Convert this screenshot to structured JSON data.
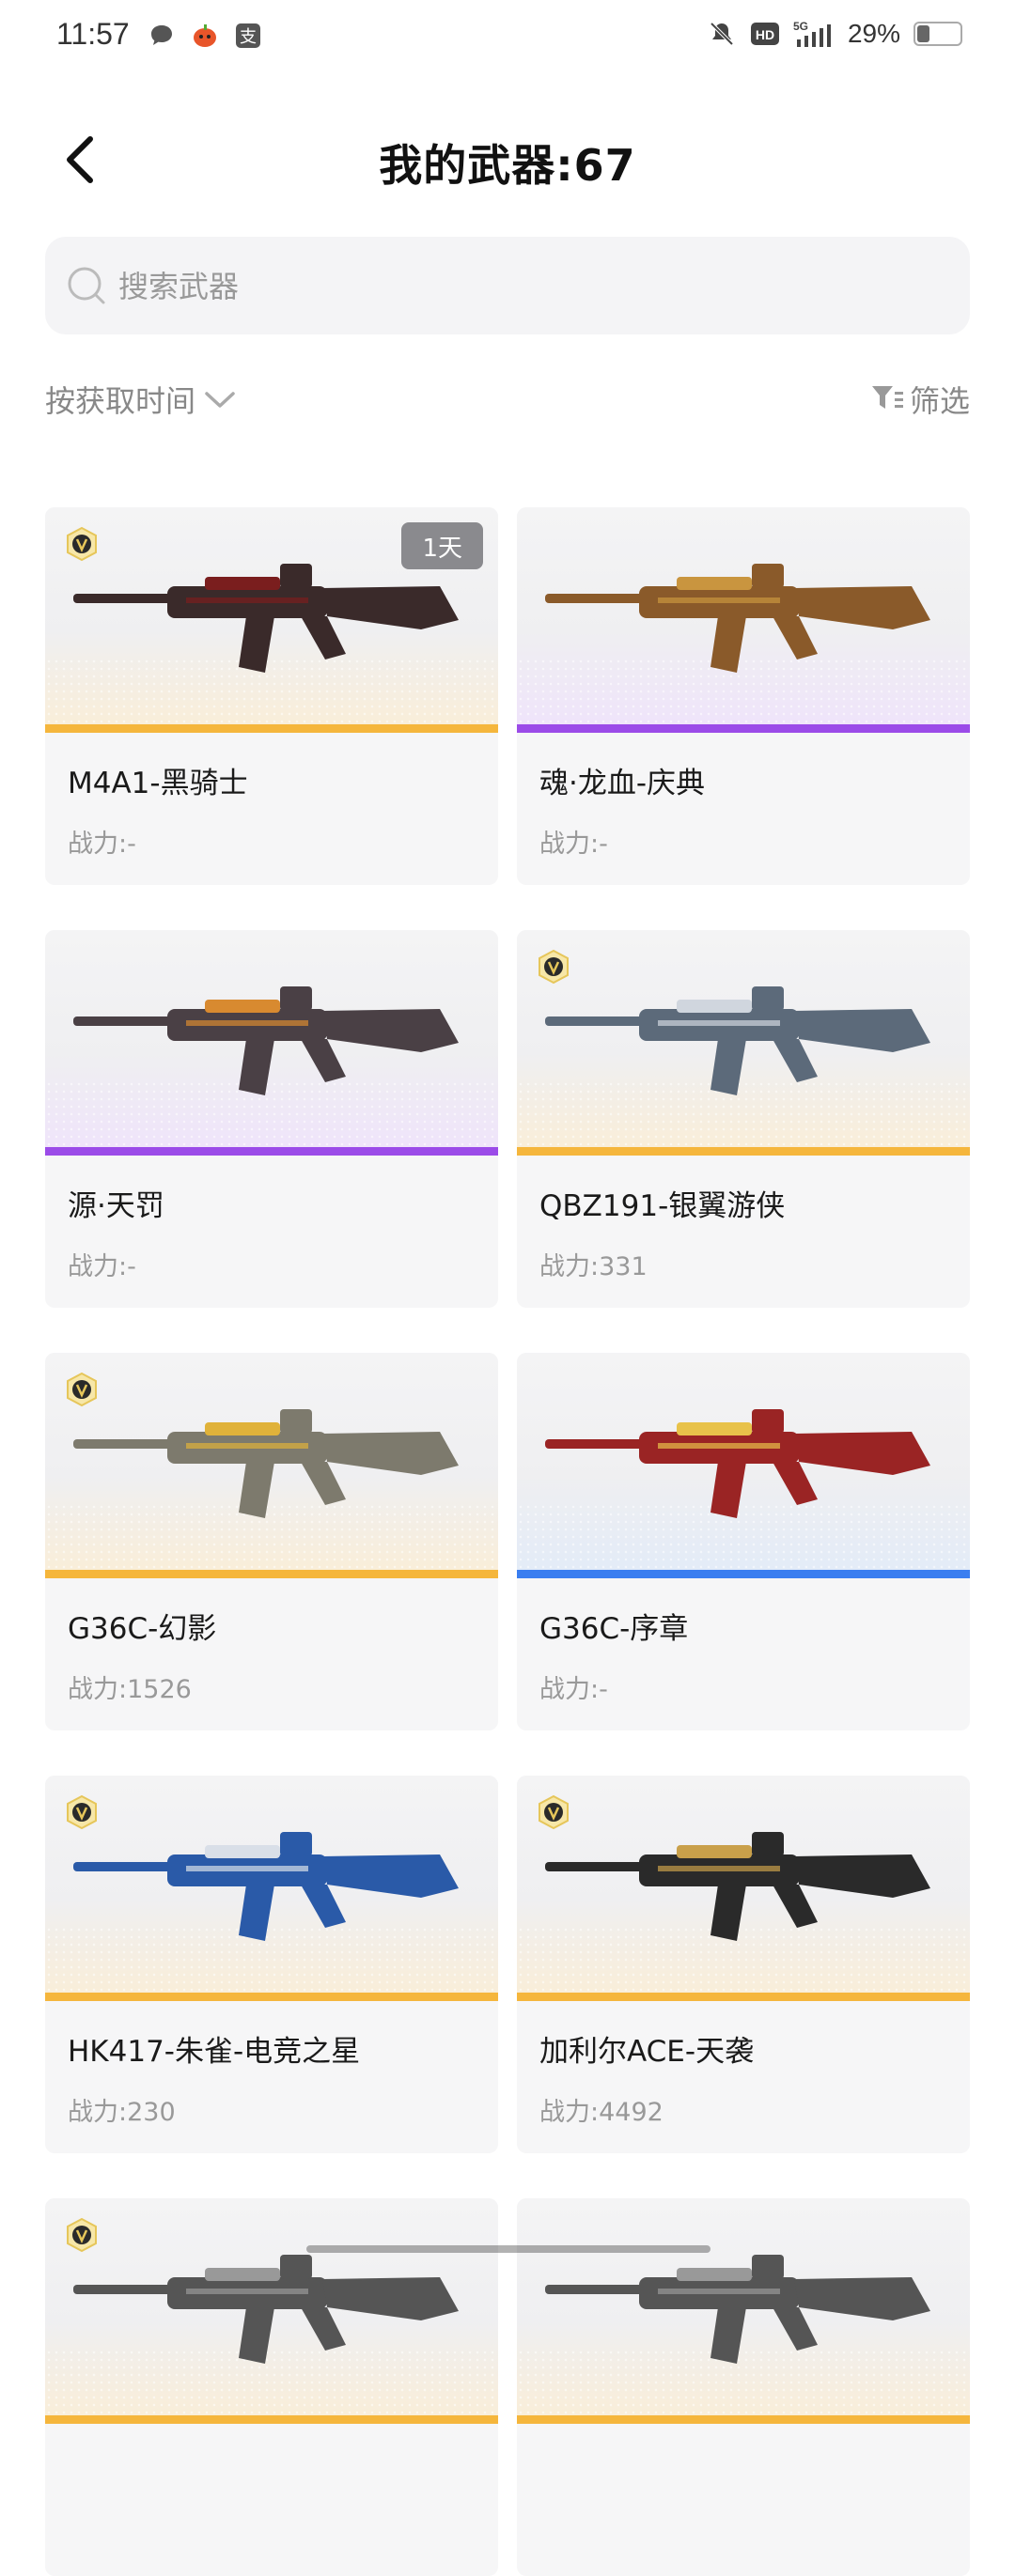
{
  "status_bar": {
    "time": "11:57",
    "battery": "29%",
    "battery_level": 0.29,
    "icons_left": [
      "chat-bubble-icon",
      "pumpkin-app-icon",
      "alipay-icon"
    ],
    "icons_right": [
      "mute-icon",
      "hd-icon",
      "signal-5g-icon",
      "battery-icon"
    ]
  },
  "header": {
    "title": "我的武器:67",
    "back_icon": "chevron-left-icon"
  },
  "search": {
    "placeholder": "搜索武器",
    "value": ""
  },
  "toolbar": {
    "sort_label": "按获取时间",
    "filter_label": "筛选"
  },
  "colors": {
    "gold": "#f5b63c",
    "purple": "#9b4be8",
    "blue": "#3a7ef0",
    "gold_tint": "#faeed7",
    "purple_tint": "#efe3fb",
    "blue_tint": "#e2ebf8"
  },
  "weapons": [
    {
      "name": "M4A1-黑骑士",
      "power": "战力:-",
      "rarity": "gold",
      "vip": true,
      "time_badge": "1天"
    },
    {
      "name": "魂·龙血-庆典",
      "power": "战力:-",
      "rarity": "purple",
      "vip": false,
      "time_badge": ""
    },
    {
      "name": "源·天罚",
      "power": "战力:-",
      "rarity": "purple",
      "vip": false,
      "time_badge": ""
    },
    {
      "name": "QBZ191-银翼游侠",
      "power": "战力:331",
      "rarity": "gold",
      "vip": true,
      "time_badge": ""
    },
    {
      "name": "G36C-幻影",
      "power": "战力:1526",
      "rarity": "gold",
      "vip": true,
      "time_badge": ""
    },
    {
      "name": "G36C-序章",
      "power": "战力:-",
      "rarity": "blue",
      "vip": false,
      "time_badge": ""
    },
    {
      "name": "HK417-朱雀-电竞之星",
      "power": "战力:230",
      "rarity": "gold",
      "vip": true,
      "time_badge": ""
    },
    {
      "name": "加利尔ACE-天袭",
      "power": "战力:4492",
      "rarity": "gold",
      "vip": true,
      "time_badge": ""
    },
    {
      "name": "",
      "power": "",
      "rarity": "gold",
      "vip": true,
      "time_badge": ""
    },
    {
      "name": "",
      "power": "",
      "rarity": "gold",
      "vip": false,
      "time_badge": ""
    }
  ]
}
